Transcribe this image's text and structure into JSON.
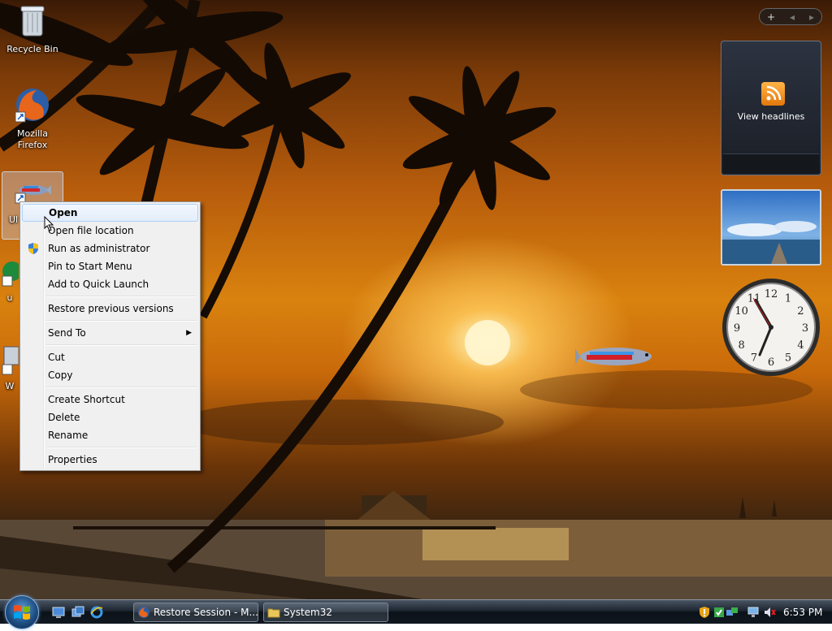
{
  "desktop": {
    "icons": [
      {
        "label": "Recycle Bin",
        "icon": "recycle-bin-icon"
      },
      {
        "label": "Mozilla Firefox",
        "icon": "firefox-icon"
      },
      {
        "label": "Ul",
        "icon": "fish-app-icon"
      },
      {
        "label": "u",
        "icon": "app-shortcut-icon"
      },
      {
        "label": "W",
        "icon": "app-shortcut-icon"
      }
    ]
  },
  "context_menu": {
    "items": [
      {
        "label": "Open",
        "bold": true,
        "hover": true
      },
      {
        "label": "Open file location"
      },
      {
        "label": "Run as administrator",
        "icon": "uac-shield-icon"
      },
      {
        "label": "Pin to Start Menu"
      },
      {
        "label": "Add to Quick Launch"
      },
      {
        "label": "Restore previous versions"
      },
      {
        "label": "Send To",
        "submenu": true
      },
      {
        "label": "Cut"
      },
      {
        "label": "Copy"
      },
      {
        "label": "Create Shortcut"
      },
      {
        "label": "Delete"
      },
      {
        "label": "Rename"
      },
      {
        "label": "Properties"
      }
    ]
  },
  "sidebar": {
    "controls": {
      "add": "+",
      "prev": "◂",
      "next": "▸"
    },
    "feed_gadget": {
      "label": "View headlines",
      "icon": "rss-icon"
    },
    "clock_gadget": {
      "numerals": [
        "12",
        "1",
        "2",
        "3",
        "4",
        "5",
        "6",
        "7",
        "8",
        "9",
        "10",
        "11"
      ]
    }
  },
  "taskbar": {
    "quick_launch": [
      "show-desktop-icon",
      "switch-windows-icon",
      "internet-explorer-icon"
    ],
    "buttons": [
      {
        "label": "Restore Session - M...",
        "icon": "firefox-icon"
      },
      {
        "label": "System32",
        "icon": "folder-icon"
      }
    ],
    "tray": {
      "icons": [
        "security-shield-icon",
        "update-icon",
        "network-icon",
        "network-status-icon",
        "volume-muted-icon"
      ],
      "time": "6:53 PM"
    }
  },
  "colors": {
    "wallpaper_sky": "#d9820f",
    "menu_background": "#f0f0f0",
    "menu_hover": "#e3edfb",
    "taskbar": "#1c2530"
  }
}
